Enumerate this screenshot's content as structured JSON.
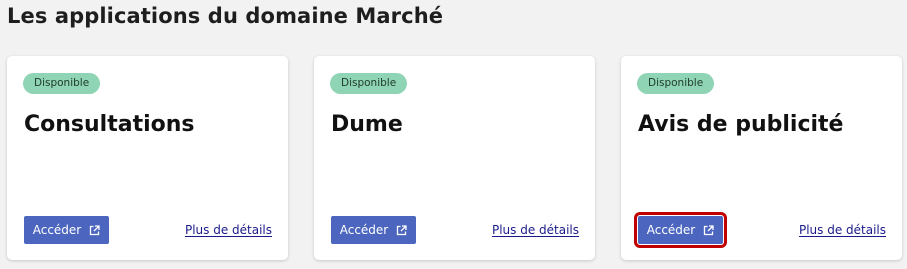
{
  "page": {
    "title": "Les applications du domaine Marché"
  },
  "cards": [
    {
      "badge": "Disponible",
      "title": "Consultations",
      "access_label": "Accéder",
      "details_label": "Plus de détails"
    },
    {
      "badge": "Disponible",
      "title": "Dume",
      "access_label": "Accéder",
      "details_label": "Plus de détails"
    },
    {
      "badge": "Disponible",
      "title": "Avis de publicité",
      "access_label": "Accéder",
      "details_label": "Plus de détails"
    }
  ],
  "icons": {
    "external_link": "external-link-icon"
  },
  "colors": {
    "badge_bg": "#8fd4b4",
    "button_bg": "#4c66c0",
    "link": "#1a1a8c",
    "highlight": "#c00000"
  }
}
